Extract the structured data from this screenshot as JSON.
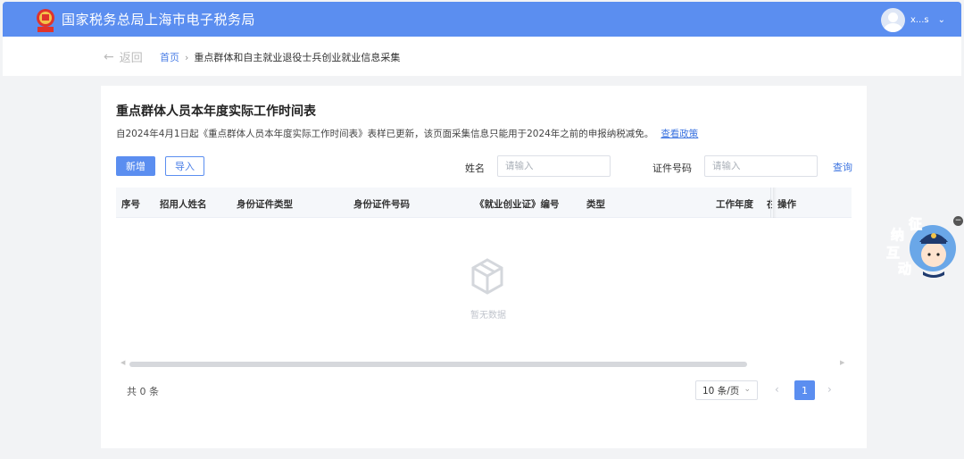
{
  "header": {
    "title": "国家税务总局上海市电子税务局",
    "user_name": "x...s",
    "user_chevron": "⌄"
  },
  "breadcrumb": {
    "back_label": "返回",
    "back_arrow": "←",
    "home": "首页",
    "separator": "›",
    "current": "重点群体和自主就业退役士兵创业就业信息采集"
  },
  "card": {
    "title": "重点群体人员本年度实际工作时间表",
    "notice": "自2024年4月1日起《重点群体人员本年度实际工作时间表》表样已更新，该页面采集信息只能用于2024年之前的申报纳税减免。",
    "notice_link": "查看政策"
  },
  "toolbar": {
    "add_label": "新增",
    "import_label": "导入",
    "name_label": "姓名",
    "name_placeholder": "请输入",
    "id_label": "证件号码",
    "id_placeholder": "请输入",
    "query_label": "查询"
  },
  "table": {
    "columns": [
      "序号",
      "招用人姓名",
      "身份证件类型",
      "身份证件号码",
      "《就业创业证》编号",
      "类型",
      "工作年度",
      "在",
      "操作"
    ],
    "empty_text": "暂无数据",
    "scroll_left": "◀",
    "scroll_right": "▶"
  },
  "pagination": {
    "total": "共 0 条",
    "page_size": "10 条/页",
    "page_size_chevron": "⌄",
    "prev": "‹",
    "current_page": "1",
    "next": "›"
  },
  "widget": {
    "chars": [
      "征",
      "纳",
      "互",
      "动"
    ],
    "close": "−"
  },
  "colors": {
    "primary": "#5b8ef0",
    "link": "#3c74e0",
    "page_bg": "#f2f3f5"
  },
  "icons": [
    "emblem-logo",
    "user-avatar",
    "chevron-down-icon",
    "back-arrow-icon",
    "empty-box-icon",
    "chevron-left-icon",
    "chevron-right-icon"
  ]
}
